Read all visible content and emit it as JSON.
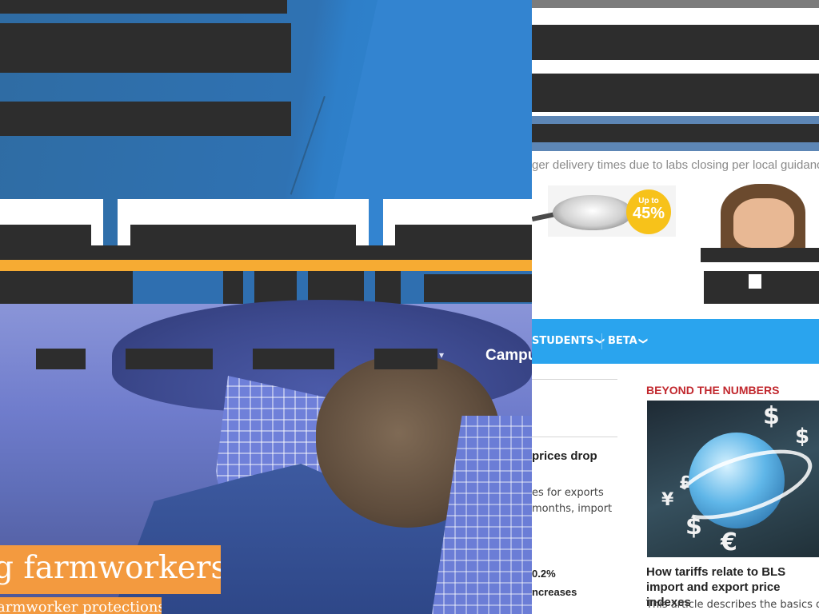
{
  "left": {
    "photo_nav": {
      "campus_label": "Campu"
    },
    "headline": "g farmworkers",
    "subhead": "armworker protections"
  },
  "right": {
    "banner_text": "ger delivery times due to labs closing per local guidance",
    "sale_badge": {
      "small": "Up to",
      "big": "45%"
    },
    "nav": {
      "items": [
        {
          "label": "STUDENTS",
          "chevron": "❯"
        },
        {
          "label": "BETA",
          "chevron": "❯"
        }
      ]
    },
    "article": {
      "title": "prices drop",
      "line1": "es for exports",
      "line2": "months, import",
      "stat_value": "0.2%",
      "stat_label": "ncreases"
    },
    "beyond_the_numbers": {
      "heading": "BEYOND THE NUMBERS",
      "article_title": "How tariffs relate to BLS import and export price indexes",
      "article_desc": "This article describes the basics on t",
      "currency_symbols": [
        "$",
        "$",
        "£",
        "¥",
        "$",
        "€"
      ]
    }
  },
  "colors": {
    "orange_accent": "#f39a3f",
    "stripe_yellow": "#f6ab33",
    "header_blue": "#2f72b3",
    "nav_light_blue": "#2aa4ee",
    "heading_red": "#c1272d",
    "redaction": "#2d2d2d"
  }
}
